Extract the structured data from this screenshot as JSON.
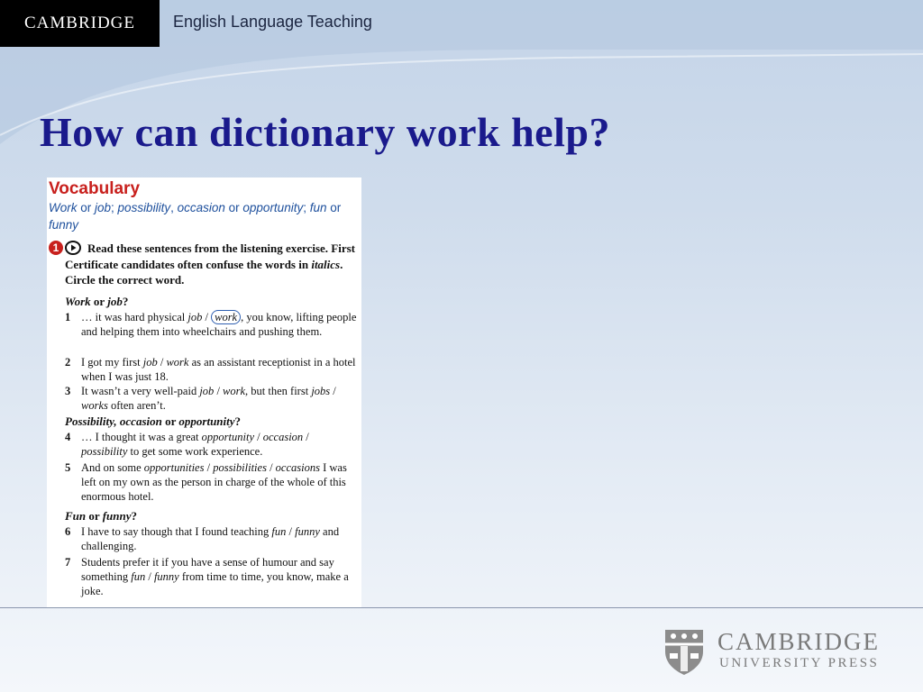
{
  "header": {
    "brand": "CAMBRIDGE",
    "subtitle": "English Language Teaching",
    "brand_bg": "#000000",
    "accent": "#c4d4e8"
  },
  "slide": {
    "title": "How can dictionary work help?",
    "title_color": "#1a1a8c"
  },
  "vocabulary": {
    "heading": "Vocabulary",
    "subheading": [
      "Work",
      " or ",
      "job",
      "; ",
      "possibility",
      ", ",
      "occasion",
      " or ",
      "opportunity",
      "; ",
      "fun",
      " or ",
      "funny"
    ],
    "exercise_number": "1",
    "exercise_icon": "play-audio-icon",
    "instruction_parts": [
      "Read these sentences from the listening exercise. First Certificate candidates often confuse the words in ",
      "italics",
      ". Circle the correct word."
    ],
    "groups": [
      {
        "title": [
          "Work",
          " or ",
          "job",
          "?"
        ],
        "items": [
          {
            "num": "1",
            "parts": [
              [
                "… it was hard physical ",
                false
              ],
              [
                "job",
                true
              ],
              [
                " / ",
                false
              ],
              [
                "work",
                "circled"
              ],
              [
                ", you know, lifting people and helping them into wheelchairs and pushing them.",
                false
              ]
            ]
          },
          {
            "num": "2",
            "parts": [
              [
                "I got my first ",
                false
              ],
              [
                "job",
                true
              ],
              [
                " / ",
                false
              ],
              [
                "work",
                true
              ],
              [
                " as an assistant receptionist in a hotel when I was just 18.",
                false
              ]
            ]
          },
          {
            "num": "3",
            "parts": [
              [
                "It wasn’t a very well-paid ",
                false
              ],
              [
                "job",
                true
              ],
              [
                " / ",
                false
              ],
              [
                "work",
                true
              ],
              [
                ", but then first ",
                false
              ],
              [
                "jobs",
                true
              ],
              [
                " / ",
                false
              ],
              [
                "works",
                true
              ],
              [
                " often aren’t.",
                false
              ]
            ]
          }
        ]
      },
      {
        "title": [
          "Possibility, occasion",
          " or ",
          "opportunity",
          "?"
        ],
        "items": [
          {
            "num": "4",
            "parts": [
              [
                "… I thought it was a great ",
                false
              ],
              [
                "opportunity",
                true
              ],
              [
                " / ",
                false
              ],
              [
                "occasion",
                true
              ],
              [
                " / ",
                false
              ],
              [
                "possibility",
                true
              ],
              [
                " to get some work experience.",
                false
              ]
            ]
          },
          {
            "num": "5",
            "parts": [
              [
                "And on some ",
                false
              ],
              [
                "opportunities",
                true
              ],
              [
                " / ",
                false
              ],
              [
                "possibilities",
                true
              ],
              [
                " / ",
                false
              ],
              [
                "occasions",
                true
              ],
              [
                " I was left on my own as the person in charge of the whole of this enormous hotel.",
                false
              ]
            ]
          }
        ]
      },
      {
        "title": [
          "Fun",
          " or ",
          "funny",
          "?"
        ],
        "items": [
          {
            "num": "6",
            "parts": [
              [
                "I have to say though that I found teaching ",
                false
              ],
              [
                "fun",
                true
              ],
              [
                " / ",
                false
              ],
              [
                "funny",
                true
              ],
              [
                " and challenging.",
                false
              ]
            ]
          },
          {
            "num": "7",
            "parts": [
              [
                "Students prefer it if you have a sense of humour and say something ",
                false
              ],
              [
                "fun",
                true
              ],
              [
                " / ",
                false
              ],
              [
                "funny",
                true
              ],
              [
                " from time to time, you know, make a joke.",
                false
              ]
            ]
          }
        ]
      }
    ]
  },
  "footer": {
    "logo_name": "CAMBRIDGE",
    "logo_press": "UNIVERSITY PRESS",
    "logo_icon": "cambridge-shield-icon"
  }
}
